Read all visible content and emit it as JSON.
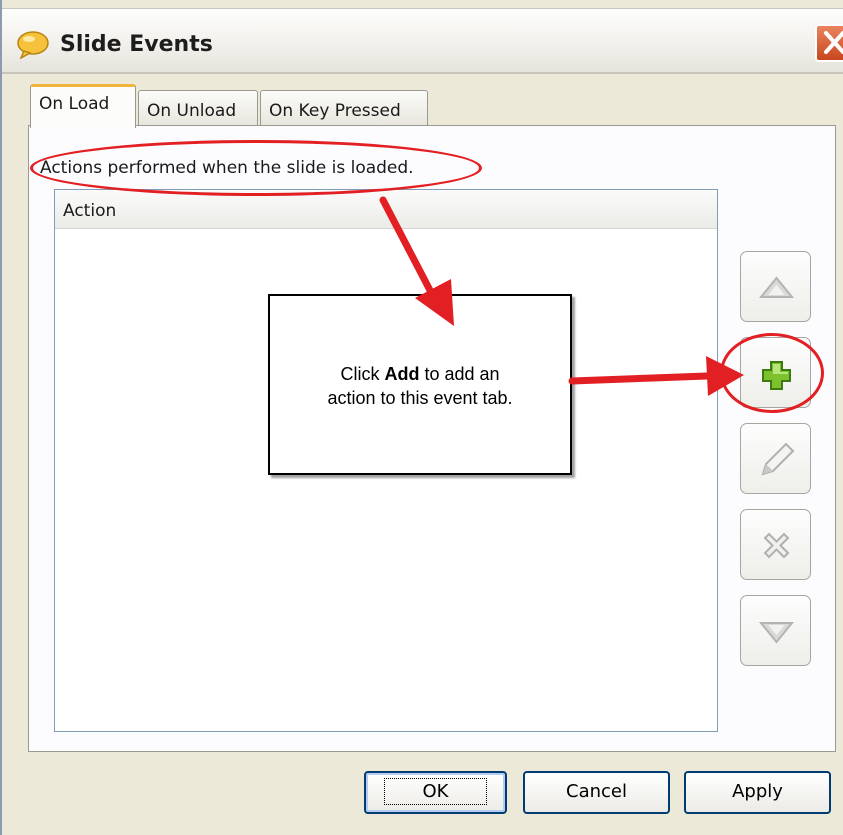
{
  "window": {
    "title": "Slide Events",
    "close_icon": "close-x-icon",
    "title_icon": "speech-bubble-icon"
  },
  "tabs": [
    {
      "label": "On Load",
      "active": true
    },
    {
      "label": "On Unload",
      "active": false
    },
    {
      "label": "On Key Pressed",
      "active": false
    }
  ],
  "description": "Actions performed when the slide is loaded.",
  "table": {
    "columns": [
      "Action"
    ],
    "rows": []
  },
  "side_buttons": [
    {
      "name": "move-up",
      "icon": "triangle-up-icon",
      "enabled": false
    },
    {
      "name": "add",
      "icon": "plus-icon",
      "enabled": true
    },
    {
      "name": "edit",
      "icon": "pencil-icon",
      "enabled": false
    },
    {
      "name": "delete",
      "icon": "x-icon",
      "enabled": false
    },
    {
      "name": "move-down",
      "icon": "triangle-down-icon",
      "enabled": false
    }
  ],
  "callout": {
    "prefix": "Click ",
    "bold": "Add",
    "suffix": " to add an",
    "line2": "action to this event tab."
  },
  "buttons": {
    "ok": "OK",
    "cancel": "Cancel",
    "apply": "Apply"
  },
  "colors": {
    "annotation_red": "#e21f22",
    "add_green": "#7cc22e",
    "tab_highlight": "#f0b43c"
  }
}
